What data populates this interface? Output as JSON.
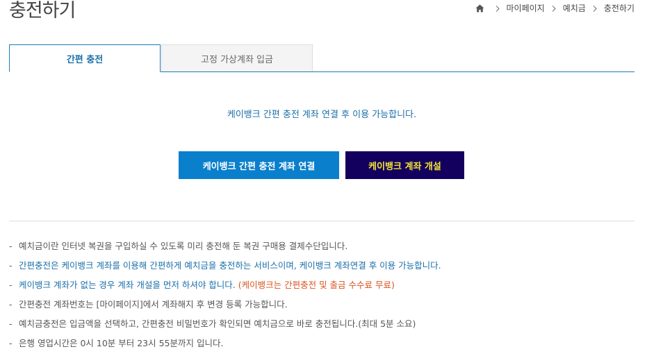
{
  "page": {
    "title": "충전하기"
  },
  "breadcrumb": {
    "home_icon": "home-icon",
    "items": [
      "마이페이지",
      "예치금",
      "충전하기"
    ]
  },
  "tabs": [
    {
      "label": "간편 충전",
      "active": true
    },
    {
      "label": "고정 가상계좌 입금",
      "active": false
    }
  ],
  "notice": "케이뱅크 간편 충전 계좌 연결 후 이용 가능합니다.",
  "buttons": {
    "link_label": "케이뱅크 간편 충전 계좌 연결",
    "open_label": "케이뱅크 계좌 개설"
  },
  "info": {
    "dash": "-",
    "line1": "예치금이란 인터넷 복권을 구입하실 수 있도록 미리 충전해 둔 복권 구매용 결제수단입니다.",
    "line2": "간편충전은 케이뱅크 계좌를 이용해 간편하게 예치금을 충전하는 서비스이며, 케이뱅크 계좌연결 후 이용 가능합니다.",
    "line3_main": "케이뱅크 계좌가 없는 경우 계좌 개설을 먼저 하셔야 합니다. ",
    "line3_note": "(케이뱅크는 간편충전 및 출금 수수료 무료)",
    "line4": "간편충전 계좌번호는 [마이페이지]에서 계좌해지 후 변경 등록 가능합니다.",
    "line5": "예치금충전은 입금액을 선택하고, 간편충전 비밀번호가 확인되면 예치금으로 바로 충전됩니다.(최대 5분 소요)",
    "line6": "은행 영업시간은 0시 10분 부터 23시 55분까지 입니다."
  },
  "colors": {
    "accent_blue": "#0a7fcc",
    "navy": "#13005e",
    "yellow_text": "#f3e531",
    "orange_text": "#d9531e"
  }
}
